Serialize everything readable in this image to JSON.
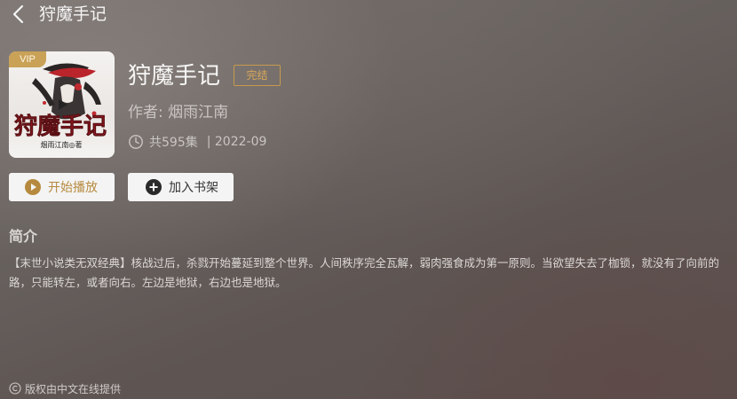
{
  "header": {
    "title": "狩魔手记"
  },
  "book": {
    "vip_label": "VIP",
    "cover_title": "狩魔手记",
    "cover_author": "烟雨江南◎著",
    "title": "狩魔手记",
    "status": "完结",
    "author": "作者: 烟雨江南",
    "episodes": "共595集",
    "date": "| 2022-09"
  },
  "actions": {
    "play_label": "开始播放",
    "shelf_label": "加入书架"
  },
  "intro": {
    "heading": "简介",
    "text": "【末世小说类无双经典】核战过后，杀戮开始蔓延到整个世界。人间秩序完全瓦解，弱肉强食成为第一原则。当欲望失去了枷锁，就没有了向前的路，只能转左，或者向右。左边是地狱，右边也是地狱。"
  },
  "footer": {
    "copyright": "版权由中文在线提供"
  },
  "colors": {
    "accent_gold": "#c69a4d",
    "vip_gold": "#c9a257",
    "button_bg": "#f4f4f4"
  },
  "icons": {
    "back": "chevron-left-icon",
    "clock": "clock-icon",
    "play": "play-circle-icon",
    "add": "plus-circle-icon",
    "copyright": "copyright-icon"
  }
}
